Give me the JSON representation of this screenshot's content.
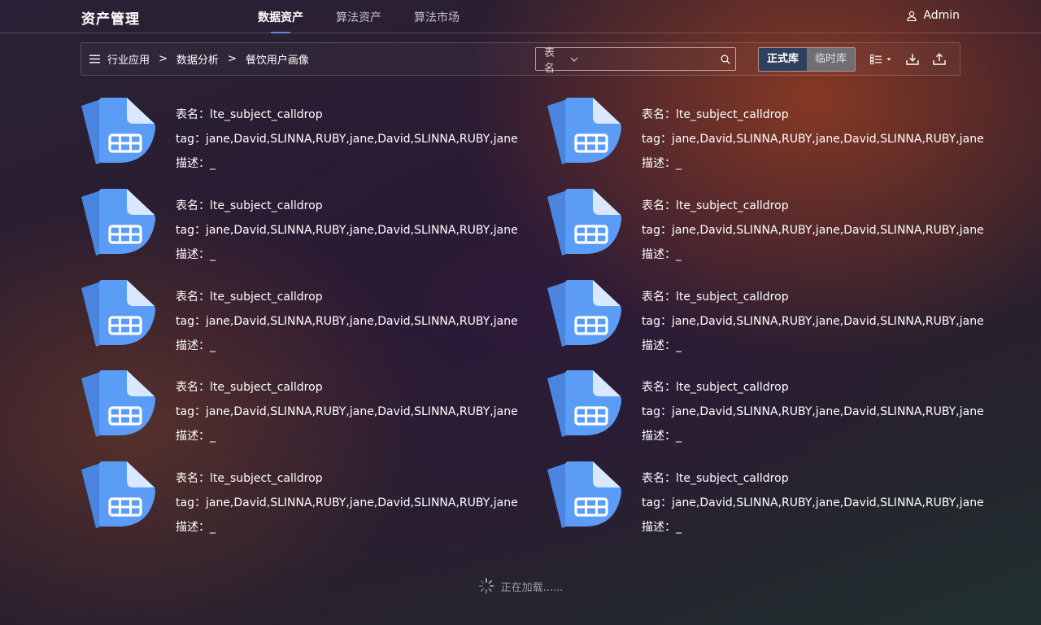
{
  "app": {
    "title": "资产管理"
  },
  "nav": {
    "tabs": [
      {
        "label": "数据资产",
        "active": true
      },
      {
        "label": "算法资产",
        "active": false
      },
      {
        "label": "算法市场",
        "active": false
      }
    ]
  },
  "user": {
    "name": "Admin",
    "icon": "user-icon"
  },
  "breadcrumb": {
    "items": [
      "行业应用",
      "数据分析",
      "餐饮用户画像"
    ],
    "separator": ">"
  },
  "search": {
    "field_label": "表名",
    "value": "",
    "placeholder": ""
  },
  "library_toggle": {
    "options": [
      "正式库",
      "临时库"
    ],
    "selected": "正式库"
  },
  "toolbar": {
    "icons": [
      "list-view-icon",
      "download-icon",
      "upload-icon"
    ]
  },
  "colors": {
    "accent": "#5a8fd8",
    "doc_icon_front": "#5b9cf6",
    "doc_icon_back": "#4a86e0",
    "segment_active": "#2f3f5e",
    "segment_inactive": "#6f6f73"
  },
  "items": [
    {
      "name_label": "表名：",
      "name": "lte_subject_calldrop",
      "tag_label": "tag：",
      "tag": "jane,David,SLINNA,RUBY,jane,David,SLINNA,RUBY,jane",
      "desc_label": "描述：",
      "desc": "_"
    },
    {
      "name_label": "表名：",
      "name": "lte_subject_calldrop",
      "tag_label": "tag：",
      "tag": "jane,David,SLINNA,RUBY,jane,David,SLINNA,RUBY,jane",
      "desc_label": "描述：",
      "desc": "_"
    },
    {
      "name_label": "表名：",
      "name": "lte_subject_calldrop",
      "tag_label": "tag：",
      "tag": "jane,David,SLINNA,RUBY,jane,David,SLINNA,RUBY,jane",
      "desc_label": "描述：",
      "desc": "_"
    },
    {
      "name_label": "表名：",
      "name": "lte_subject_calldrop",
      "tag_label": "tag：",
      "tag": "jane,David,SLINNA,RUBY,jane,David,SLINNA,RUBY,jane",
      "desc_label": "描述：",
      "desc": "_"
    },
    {
      "name_label": "表名：",
      "name": "lte_subject_calldrop",
      "tag_label": "tag：",
      "tag": "jane,David,SLINNA,RUBY,jane,David,SLINNA,RUBY,jane",
      "desc_label": "描述：",
      "desc": "_"
    },
    {
      "name_label": "表名：",
      "name": "lte_subject_calldrop",
      "tag_label": "tag：",
      "tag": "jane,David,SLINNA,RUBY,jane,David,SLINNA,RUBY,jane",
      "desc_label": "描述：",
      "desc": "_"
    },
    {
      "name_label": "表名：",
      "name": "lte_subject_calldrop",
      "tag_label": "tag：",
      "tag": "jane,David,SLINNA,RUBY,jane,David,SLINNA,RUBY,jane",
      "desc_label": "描述：",
      "desc": "_"
    },
    {
      "name_label": "表名：",
      "name": "lte_subject_calldrop",
      "tag_label": "tag：",
      "tag": "jane,David,SLINNA,RUBY,jane,David,SLINNA,RUBY,jane",
      "desc_label": "描述：",
      "desc": "_"
    },
    {
      "name_label": "表名：",
      "name": "lte_subject_calldrop",
      "tag_label": "tag：",
      "tag": "jane,David,SLINNA,RUBY,jane,David,SLINNA,RUBY,jane",
      "desc_label": "描述：",
      "desc": "_"
    },
    {
      "name_label": "表名：",
      "name": "lte_subject_calldrop",
      "tag_label": "tag：",
      "tag": "jane,David,SLINNA,RUBY,jane,David,SLINNA,RUBY,jane",
      "desc_label": "描述：",
      "desc": "_"
    }
  ],
  "loading": {
    "text": "正在加载......",
    "icon": "spinner-icon"
  }
}
